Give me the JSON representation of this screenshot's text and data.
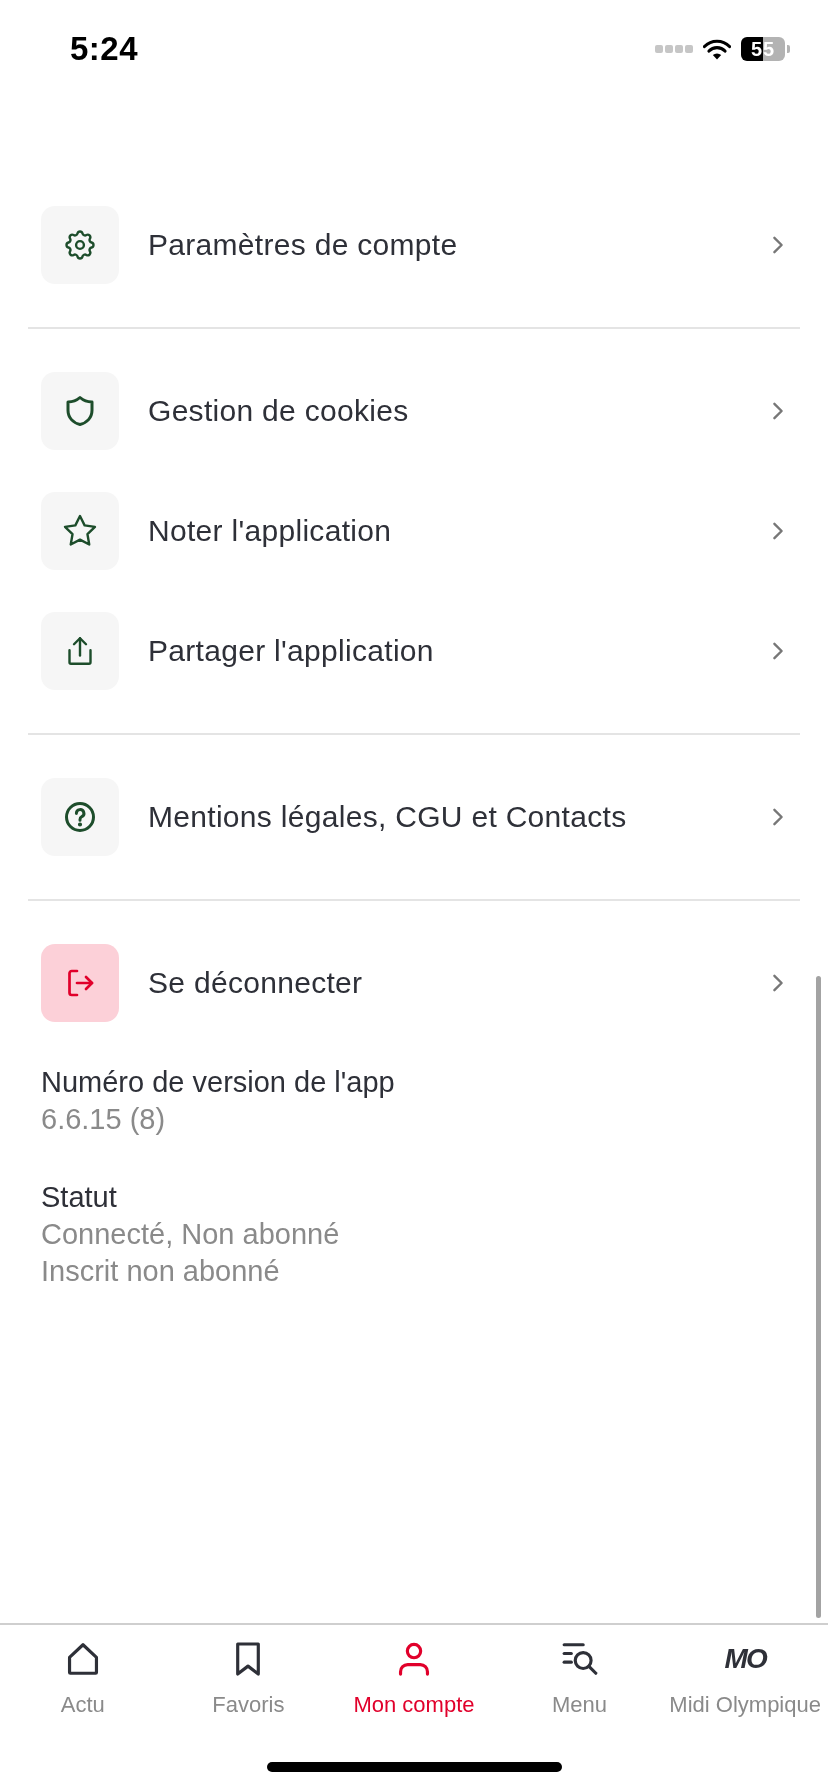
{
  "status_bar": {
    "time": "5:24",
    "battery": "55"
  },
  "menu_groups": [
    {
      "items": [
        {
          "kind": "gear",
          "label": "Paramètres de compte"
        }
      ]
    },
    {
      "items": [
        {
          "kind": "shield",
          "label": "Gestion de cookies"
        },
        {
          "kind": "star",
          "label": "Noter l'application"
        },
        {
          "kind": "share",
          "label": "Partager l'application"
        }
      ]
    },
    {
      "items": [
        {
          "kind": "help",
          "label": "Mentions légales, CGU et Contacts"
        }
      ]
    },
    {
      "items": [
        {
          "kind": "logout",
          "label": "Se déconnecter"
        }
      ]
    }
  ],
  "info": [
    {
      "label": "Numéro de version de l'app",
      "values": [
        "6.6.15 (8)"
      ]
    },
    {
      "label": "Statut",
      "values": [
        "Connecté, Non abonné",
        "Inscrit non abonné"
      ]
    }
  ],
  "tab_bar": {
    "tabs": [
      {
        "kind": "home",
        "label": "Actu",
        "selected": false
      },
      {
        "kind": "bookmark",
        "label": "Favoris",
        "selected": false
      },
      {
        "kind": "account",
        "label": "Mon compte",
        "selected": true
      },
      {
        "kind": "menu",
        "label": "Menu",
        "selected": false
      },
      {
        "kind": "logo",
        "logo_text": "MO",
        "label": "Midi Olympique",
        "selected": false
      }
    ]
  }
}
